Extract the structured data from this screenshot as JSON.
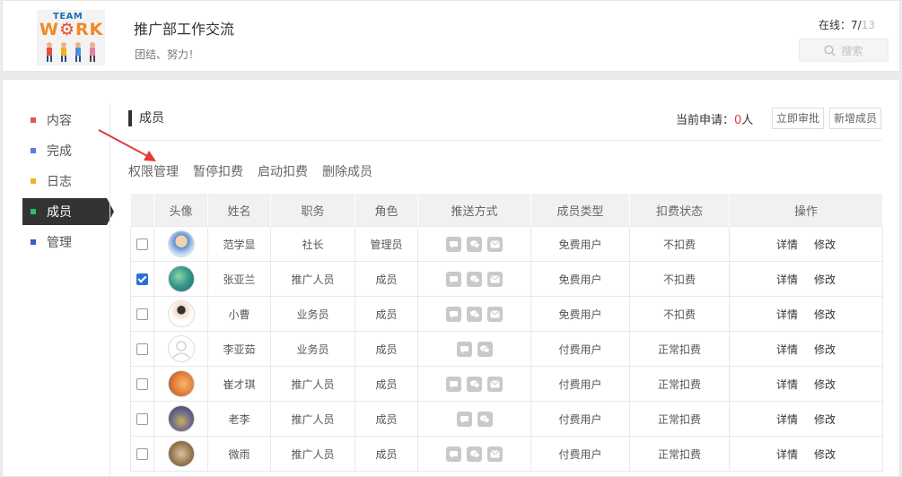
{
  "header": {
    "logo": {
      "line1": "TEAM",
      "line2_a": "W",
      "line2_b": "RK",
      "gear": "⚙"
    },
    "team_name": "推广部工作交流",
    "slogan": "团结、努力！",
    "online_label": "在线：",
    "online_count": "7",
    "online_sep": "/",
    "online_total": "13",
    "search_label": "搜索",
    "search_icon": "search-icon"
  },
  "sidebar": {
    "items": [
      {
        "label": "内容",
        "color": "#e05a4b",
        "active": false
      },
      {
        "label": "完成",
        "color": "#5a7ee0",
        "active": false
      },
      {
        "label": "日志",
        "color": "#f0b31d",
        "active": false
      },
      {
        "label": "成员",
        "color": "#2bbf6a",
        "active": true
      },
      {
        "label": "管理",
        "color": "#3a5cc7",
        "active": false
      }
    ]
  },
  "section": {
    "title": "成员",
    "apply_label": "当前申请：",
    "apply_count": "0",
    "apply_unit": "人",
    "approve_button": "立即审批",
    "add_button": "新增成员"
  },
  "actions": [
    "权限管理",
    "暂停扣费",
    "启动扣费",
    "删除成员"
  ],
  "table": {
    "headers": [
      "",
      "头像",
      "姓名",
      "职务",
      "角色",
      "推送方式",
      "成员类型",
      "扣费状态",
      "操作"
    ],
    "op_detail": "详情",
    "op_edit": "修改",
    "rows": [
      {
        "checked": false,
        "avatar": "photo-man",
        "name": "范学显",
        "title": "社长",
        "role": "管理员",
        "push": [
          "chat-icon",
          "wechat-icon",
          "mail-icon"
        ],
        "type": "免费用户",
        "fee": "不扣费"
      },
      {
        "checked": true,
        "avatar": "photo-earth",
        "name": "张亚兰",
        "title": "推广人员",
        "role": "成员",
        "push": [
          "chat-icon",
          "wechat-icon",
          "mail-icon"
        ],
        "type": "免费用户",
        "fee": "不扣费"
      },
      {
        "checked": false,
        "avatar": "photo-girl",
        "name": "小曹",
        "title": "业务员",
        "role": "成员",
        "push": [
          "chat-icon",
          "wechat-icon",
          "mail-icon"
        ],
        "type": "免费用户",
        "fee": "不扣费"
      },
      {
        "checked": false,
        "avatar": "default-avatar",
        "name": "李亚茹",
        "title": "业务员",
        "role": "成员",
        "push": [
          "chat-icon",
          "wechat-icon"
        ],
        "type": "付费用户",
        "fee": "正常扣费"
      },
      {
        "checked": false,
        "avatar": "photo-orange",
        "name": "崔才琪",
        "title": "推广人员",
        "role": "成员",
        "push": [
          "chat-icon",
          "wechat-icon",
          "mail-icon"
        ],
        "type": "付费用户",
        "fee": "正常扣费"
      },
      {
        "checked": false,
        "avatar": "photo-crowd",
        "name": "老李",
        "title": "推广人员",
        "role": "成员",
        "push": [
          "chat-icon",
          "wechat-icon"
        ],
        "type": "付费用户",
        "fee": "正常扣费"
      },
      {
        "checked": false,
        "avatar": "photo-brown",
        "name": "微雨",
        "title": "推广人员",
        "role": "成员",
        "push": [
          "chat-icon",
          "wechat-icon",
          "mail-icon"
        ],
        "type": "付费用户",
        "fee": "正常扣费"
      }
    ]
  },
  "colors": {
    "accent_red": "#e4393c",
    "sidebar_active": "#333333",
    "checkbox_blue": "#2b6fd6"
  }
}
